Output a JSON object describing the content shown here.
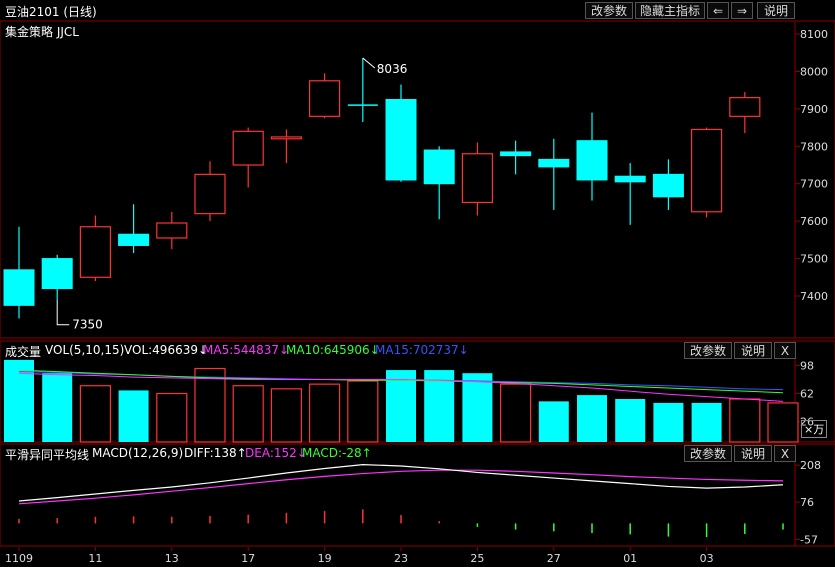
{
  "title": "豆油2101 (日线)",
  "subtitle": "集金策略 JJCL",
  "toolbar": {
    "params": "改参数",
    "hide_main": "隐藏主指标",
    "left": "⇐",
    "right": "⇒",
    "help": "说明"
  },
  "panel_buttons": {
    "params": "改参数",
    "help": "说明",
    "close": "X"
  },
  "vol_panel": {
    "name": "成交量",
    "formula": "VOL(5,10,15)",
    "vol": "VOL:496639↓",
    "ma5": "MA5:544837↓",
    "ma10": "MA10:645906↓",
    "ma15": "MA15:702737↓",
    "unit": "×万"
  },
  "macd_panel": {
    "name": "平滑异同平均线",
    "formula": "MACD(12,26,9)",
    "diff": "DIFF:138↑",
    "dea": "DEA:152↓",
    "macd": "MACD:-28↑"
  },
  "colors": {
    "up": "#ff3232",
    "down": "#00ffff",
    "ma5": "#ff33ff",
    "ma10": "#33ff33",
    "ma15": "#3355ff",
    "diff": "#ffffff",
    "dea": "#ff33ff"
  },
  "chart_data": [
    {
      "type": "candlestick",
      "ylim": [
        7320,
        8120
      ],
      "yticks": [
        7400,
        7500,
        7600,
        7700,
        7800,
        7900,
        8000,
        8100
      ],
      "annotations": [
        {
          "label": "8036",
          "index": 9
        },
        {
          "label": "7350",
          "index": 1
        }
      ],
      "candles": [
        {
          "o": 7470,
          "h": 7585,
          "l": 7340,
          "c": 7375
        },
        {
          "o": 7500,
          "h": 7510,
          "l": 7390,
          "c": 7420
        },
        {
          "o": 7450,
          "h": 7615,
          "l": 7440,
          "c": 7585
        },
        {
          "o": 7565,
          "h": 7645,
          "l": 7515,
          "c": 7535
        },
        {
          "o": 7555,
          "h": 7625,
          "l": 7525,
          "c": 7595
        },
        {
          "o": 7620,
          "h": 7760,
          "l": 7600,
          "c": 7725
        },
        {
          "o": 7750,
          "h": 7850,
          "l": 7690,
          "c": 7840
        },
        {
          "o": 7820,
          "h": 7845,
          "l": 7755,
          "c": 7825
        },
        {
          "o": 7880,
          "h": 7995,
          "l": 7875,
          "c": 7975
        },
        {
          "o": 7910,
          "h": 8036,
          "l": 7865,
          "c": 7910
        },
        {
          "o": 7925,
          "h": 7965,
          "l": 7705,
          "c": 7710
        },
        {
          "o": 7790,
          "h": 7800,
          "l": 7605,
          "c": 7700
        },
        {
          "o": 7650,
          "h": 7810,
          "l": 7615,
          "c": 7780
        },
        {
          "o": 7785,
          "h": 7815,
          "l": 7725,
          "c": 7775
        },
        {
          "o": 7765,
          "h": 7820,
          "l": 7630,
          "c": 7745
        },
        {
          "o": 7815,
          "h": 7890,
          "l": 7655,
          "c": 7710
        },
        {
          "o": 7720,
          "h": 7755,
          "l": 7590,
          "c": 7705
        },
        {
          "o": 7725,
          "h": 7765,
          "l": 7630,
          "c": 7665
        },
        {
          "o": 7625,
          "h": 7850,
          "l": 7610,
          "c": 7845
        },
        {
          "o": 7880,
          "h": 7945,
          "l": 7835,
          "c": 7930
        }
      ]
    },
    {
      "type": "bar",
      "name": "成交量",
      "yticks": [
        26,
        62,
        98
      ],
      "ylim": [
        0,
        110
      ],
      "volumes": [
        105,
        88,
        72,
        66,
        62,
        94,
        72,
        68,
        74,
        78,
        92,
        92,
        88,
        74,
        52,
        60,
        55,
        50,
        50,
        55,
        50
      ],
      "up": [
        false,
        false,
        true,
        false,
        true,
        true,
        true,
        true,
        true,
        true,
        false,
        false,
        false,
        true,
        false,
        false,
        false,
        false,
        false,
        true,
        true
      ],
      "ma5": [
        88,
        86,
        85,
        83,
        82,
        81,
        80,
        80,
        80,
        80,
        80,
        79,
        77,
        75,
        72,
        69,
        65,
        61,
        58,
        55,
        52
      ],
      "ma10": [
        92,
        90,
        88,
        86,
        84,
        82,
        81,
        80,
        80,
        79,
        79,
        78,
        77,
        76,
        75,
        73,
        71,
        69,
        67,
        65,
        63
      ],
      "ma15": [
        90,
        89,
        87,
        86,
        84,
        83,
        82,
        81,
        80,
        80,
        79,
        79,
        78,
        77,
        76,
        75,
        73,
        72,
        70,
        68,
        67
      ]
    },
    {
      "type": "line",
      "name": "MACD",
      "yticks": [
        -57,
        76,
        208
      ],
      "ylim": [
        -70,
        230
      ],
      "diff": [
        80,
        92,
        105,
        118,
        130,
        145,
        162,
        180,
        196,
        210,
        205,
        195,
        182,
        172,
        162,
        152,
        142,
        132,
        126,
        130,
        138
      ],
      "dea": [
        70,
        80,
        90,
        102,
        115,
        128,
        142,
        156,
        168,
        178,
        186,
        190,
        190,
        186,
        180,
        174,
        167,
        162,
        157,
        154,
        152
      ],
      "hist": [
        20,
        24,
        30,
        32,
        30,
        34,
        40,
        48,
        56,
        64,
        38,
        10,
        -16,
        -28,
        -36,
        -44,
        -50,
        -60,
        -62,
        -48,
        -28
      ]
    }
  ],
  "x_ticks": [
    {
      "label": "1109",
      "index": 0
    },
    {
      "label": "11",
      "index": 2
    },
    {
      "label": "13",
      "index": 4
    },
    {
      "label": "17",
      "index": 6
    },
    {
      "label": "19",
      "index": 8
    },
    {
      "label": "23",
      "index": 10
    },
    {
      "label": "25",
      "index": 12
    },
    {
      "label": "27",
      "index": 14
    },
    {
      "label": "01",
      "index": 16
    },
    {
      "label": "03",
      "index": 18
    }
  ]
}
